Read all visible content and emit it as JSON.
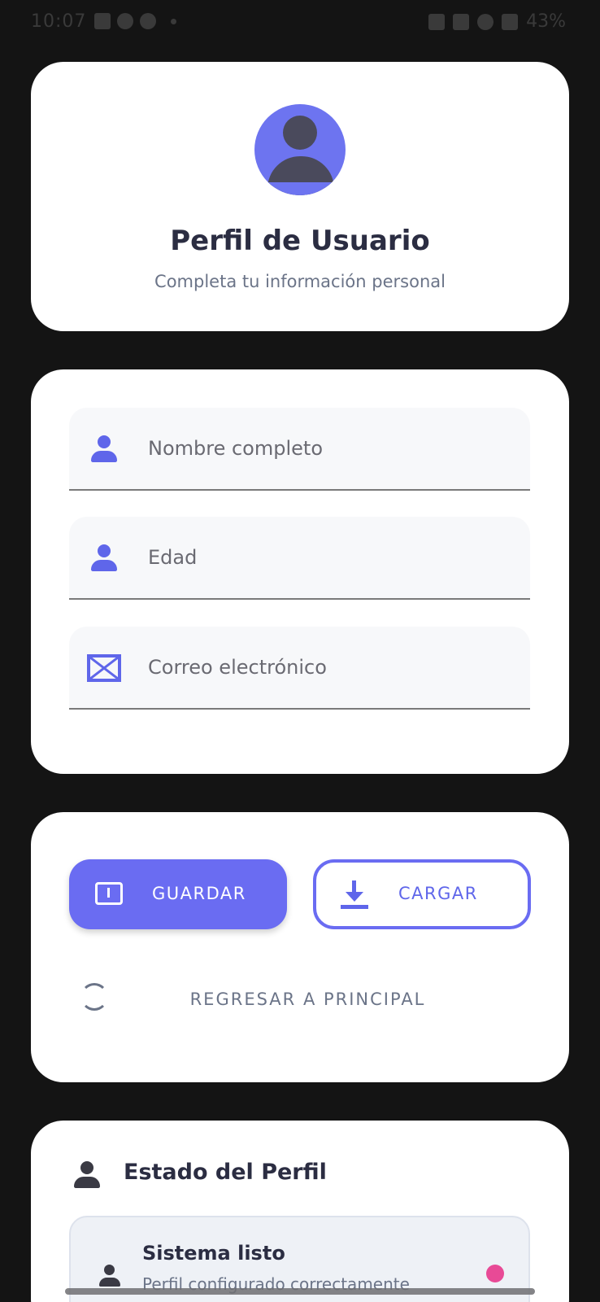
{
  "status_bar": {
    "time": "10:07",
    "battery": "43%"
  },
  "header": {
    "title": "Perfil de Usuario",
    "subtitle": "Completa tu información personal"
  },
  "form": {
    "name_placeholder": "Nombre completo",
    "age_placeholder": "Edad",
    "email_placeholder": "Correo electrónico"
  },
  "actions": {
    "save_label": "GUARDAR",
    "load_label": "CARGAR",
    "back_label": "REGRESAR A PRINCIPAL"
  },
  "status": {
    "title": "Estado del Perfil",
    "item_title": "Sistema listo",
    "item_subtitle": "Perfil configurado correctamente",
    "dot_color": "#e84a96"
  },
  "colors": {
    "accent": "#6a6cf2",
    "background": "#141414"
  }
}
